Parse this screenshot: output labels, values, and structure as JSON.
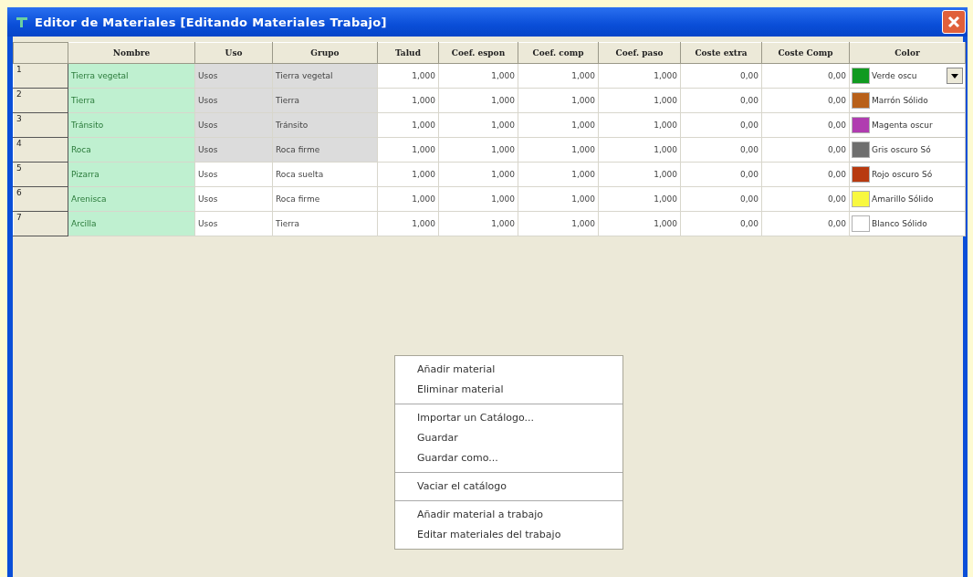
{
  "window": {
    "title": "Editor de Materiales [Editando Materiales Trabajo]"
  },
  "table": {
    "columns": [
      "Nombre",
      "Uso",
      "Grupo",
      "Talud",
      "Coef. espon",
      "Coef. comp",
      "Coef. paso",
      "Coste extra",
      "Coste Comp",
      "Color"
    ],
    "rows": [
      {
        "number": "1",
        "readonly": true,
        "cells": [
          "Tierra vegetal",
          "Usos",
          "Tierra vegetal",
          "1,000",
          "1,000",
          "1,000",
          "1,000",
          "0,00",
          "0,00"
        ],
        "color": {
          "label": "Verde oscu",
          "color": "#109a20",
          "dropdown": true
        }
      },
      {
        "number": "2",
        "readonly": true,
        "cells": [
          "Tierra",
          "Usos",
          "Tierra",
          "1,000",
          "1,000",
          "1,000",
          "1,000",
          "0,00",
          "0,00"
        ],
        "color": {
          "label": "Marrón Sólido",
          "color": "#b8601a",
          "dropdown": false
        }
      },
      {
        "number": "3",
        "readonly": true,
        "cells": [
          "Tránsito",
          "Usos",
          "Tránsito",
          "1,000",
          "1,000",
          "1,000",
          "1,000",
          "0,00",
          "0,00"
        ],
        "color": {
          "label": "Magenta oscur",
          "color": "#b03cb0",
          "dropdown": false
        }
      },
      {
        "number": "4",
        "readonly": true,
        "cells": [
          "Roca",
          "Usos",
          "Roca firme",
          "1,000",
          "1,000",
          "1,000",
          "1,000",
          "0,00",
          "0,00"
        ],
        "color": {
          "label": "Gris oscuro Só",
          "color": "#6e6e6e",
          "dropdown": false
        }
      },
      {
        "number": "5",
        "readonly": false,
        "cells": [
          "Pizarra",
          "Usos",
          "Roca suelta",
          "1,000",
          "1,000",
          "1,000",
          "1,000",
          "0,00",
          "0,00"
        ],
        "color": {
          "label": "Rojo oscuro Só",
          "color": "#b83a10",
          "dropdown": false
        }
      },
      {
        "number": "6",
        "readonly": false,
        "cells": [
          "Arenisca",
          "Usos",
          "Roca firme",
          "1,000",
          "1,000",
          "1,000",
          "1,000",
          "0,00",
          "0,00"
        ],
        "color": {
          "label": "Amarillo Sólido",
          "color": "#f8f840",
          "dropdown": false
        }
      },
      {
        "number": "7",
        "readonly": false,
        "cells": [
          "Arcilla",
          "Usos",
          "Tierra",
          "1,000",
          "1,000",
          "1,000",
          "1,000",
          "0,00",
          "0,00"
        ],
        "color": {
          "label": "Blanco Sólido",
          "color": "#ffffff",
          "dropdown": false
        }
      }
    ]
  },
  "context_menu": {
    "groups": [
      [
        "Añadir material",
        "Eliminar material"
      ],
      [
        "Importar un Catálogo...",
        "Guardar",
        "Guardar como..."
      ],
      [
        "Vaciar el catálogo"
      ],
      [
        "Añadir material a trabajo",
        "Editar materiales del trabajo"
      ]
    ]
  }
}
